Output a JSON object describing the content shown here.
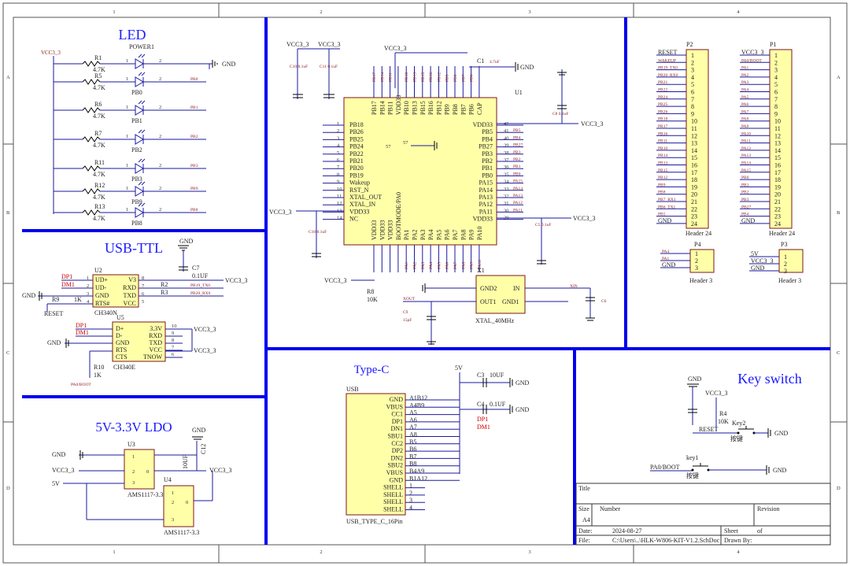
{
  "sections": {
    "led": "LED",
    "usb_ttl": "USB-TTL",
    "ldo": "5V-3.3V LDO",
    "typec": "Type-C",
    "key": "Key switch"
  },
  "border": {
    "cols": [
      "1",
      "2",
      "3",
      "4"
    ],
    "rows": [
      "A",
      "B",
      "C",
      "D"
    ]
  },
  "nets": {
    "vcc": "VCC3_3",
    "gnd": "GND",
    "v5": "5V",
    "reset": "RESET",
    "dp1": "DP1",
    "dm1": "DM1",
    "xin": "XIN",
    "xout": "XOUT",
    "pa0boot": "PA0/BOOT"
  },
  "led": {
    "resistors": [
      {
        "ref": "R1",
        "val": "4.7K",
        "led": "POWER1",
        "net": ""
      },
      {
        "ref": "R5",
        "val": "4.7K",
        "led": "PB0",
        "net": "PB0"
      },
      {
        "ref": "R6",
        "val": "4.7K",
        "led": "PB1",
        "net": "PB1"
      },
      {
        "ref": "R7",
        "val": "4.7K",
        "led": "PB2",
        "net": "PB2"
      },
      {
        "ref": "R11",
        "val": "4.7K",
        "led": "PB3",
        "net": "PB3"
      },
      {
        "ref": "R12",
        "val": "4.7K",
        "led": "PB9",
        "net": "PB9"
      },
      {
        "ref": "R13",
        "val": "4.7K",
        "led": "PB8",
        "net": "PB8"
      }
    ]
  },
  "usb_ttl": {
    "u2": {
      "ref": "U2",
      "name": "CH340N",
      "left": [
        "UD+",
        "UD-",
        "GND",
        "RTS#"
      ],
      "right": [
        "V3",
        "RXD",
        "TXD",
        "VCC"
      ]
    },
    "u5": {
      "ref": "U5",
      "name": "CH340E",
      "left": [
        "D+",
        "D-",
        "GND",
        "RTS",
        "CTS"
      ],
      "right": [
        "3.3V",
        "RXD",
        "TXD",
        "VCC",
        "TNOW"
      ]
    },
    "c7": {
      "ref": "C7",
      "val": "0.1UF"
    },
    "r2": "R2",
    "r3": "R3",
    "r9": "R9",
    "r9v": "1K",
    "r10": "R10",
    "r10v": "1K",
    "nets": [
      "PB19_TX0",
      "PB20_RX0"
    ]
  },
  "mcu": {
    "ref": "U1",
    "center": "57",
    "left": [
      "PB18",
      "PB26",
      "PB25",
      "PB24",
      "PB22",
      "PB21",
      "PB20",
      "PB19",
      "Wakeup",
      "RST_N",
      "XTAL_OUT",
      "XTAL_IN",
      "VDD33",
      "NC"
    ],
    "right": [
      "VDD33",
      "PB5",
      "PB4",
      "PB27",
      "PB3",
      "PB2",
      "PB1",
      "PB0",
      "PA15",
      "PA14",
      "PA13",
      "PA12",
      "PA11",
      "VDD33"
    ],
    "top": [
      "PB17",
      "PB14",
      "PB11",
      "VDD33",
      "PB10",
      "PB13",
      "PB15",
      "PB16",
      "PB12",
      "PB9",
      "PB8",
      "PB7",
      "PB6",
      "CAP"
    ],
    "bottom": [
      "VDD33",
      "VDD33",
      "VDD33",
      "BOOTMODE/PA0",
      "PA1",
      "PA2",
      "PA3",
      "PA4",
      "PA5",
      "PA6",
      "PA7",
      "PA8",
      "PA9",
      "PA10"
    ],
    "c1": "C1",
    "c1v": "4.7uF",
    "c10v": "C10 0.1uF",
    "c11v": "C11 0.1uF",
    "c5v": "C5 0.1uF",
    "c8v": "C8 0.1uF",
    "r8": "R8",
    "r8v": "10K"
  },
  "xtal": {
    "ref": "X1",
    "name": "XTAL_40MHz",
    "left": [
      "GND2",
      "OUT1"
    ],
    "right": [
      "IN",
      "GND1"
    ],
    "c9": "C9",
    "c9v": "15pF",
    "c6": "C6"
  },
  "headers": {
    "p2": {
      "ref": "P2",
      "name": "Header 24",
      "nets": [
        "RESET",
        "WAKEUP",
        "PB19_TX0",
        "PB20_RX0",
        "PB21",
        "PB22",
        "PB24",
        "PB25",
        "PB26",
        "PB18",
        "PB17",
        "PB16",
        "PB11",
        "PB10",
        "PB14",
        "PB13",
        "PB15",
        "PB12",
        "PB9",
        "PB8",
        "PB7_RX1",
        "PB6_TX1",
        "PB5",
        "GND"
      ]
    },
    "p1": {
      "ref": "P1",
      "name": "Header 24",
      "nets": [
        "VCC3_3",
        "PA0/BOOT",
        "PA1",
        "PA2",
        "PA3",
        "PA4",
        "PA5",
        "PA6",
        "PA7",
        "PA8",
        "PA9",
        "PA10",
        "PA11",
        "PA12",
        "PA13",
        "PA14",
        "PA15",
        "PB0",
        "PB1",
        "PB2",
        "PB3",
        "PB27",
        "PB4",
        "GND"
      ]
    },
    "p4": {
      "ref": "P4",
      "name": "Header 3",
      "nets": [
        "PA4",
        "PA1",
        "GND"
      ]
    },
    "p3": {
      "ref": "P3",
      "name": "Header 3",
      "nets": [
        "5V",
        "VCC3_3",
        "GND"
      ]
    }
  },
  "ldo": {
    "u3": "U3",
    "u4": "U4",
    "part": "AMS1117-3.3",
    "c12": "C12",
    "c12v": "10UF"
  },
  "typec": {
    "ref": "USB",
    "name": "USB_TYPE_C_16Pin",
    "pins": [
      "GND",
      "VBUS",
      "CC1",
      "DP1",
      "DN1",
      "SBU1",
      "CC2",
      "DP2",
      "DN2",
      "SBU2",
      "VBUS",
      "GND",
      "SHELL",
      "SHELL",
      "SHELL",
      "SHELL"
    ],
    "nums": [
      "A1B12",
      "A4B9",
      "A5",
      "A6",
      "A7",
      "A8",
      "B5",
      "B6",
      "B7",
      "B8",
      "B4A9",
      "B1A12",
      "1",
      "2",
      "3",
      "4"
    ],
    "c3": "C3",
    "c3v": "10UF",
    "c4": "C4",
    "c4v": "0.1UF"
  },
  "key": {
    "k2": "Key2",
    "k1": "key1",
    "press": "按键",
    "r4": "R4",
    "r4v": "10K",
    "c2": "C2",
    "c2v": "0.1UF"
  },
  "title": {
    "title_lbl": "Title",
    "size_lbl": "Size",
    "size": "A4",
    "number_lbl": "Number",
    "rev_lbl": "Revision",
    "date_lbl": "Date:",
    "date": "2024-08-27",
    "sheet_lbl": "Sheet",
    "of_lbl": "of",
    "file_lbl": "File:",
    "file": "C:\\Users\\..\\HLK-W806-KIT-V1.2.SchDoc",
    "drawn_lbl": "Drawn By:"
  }
}
